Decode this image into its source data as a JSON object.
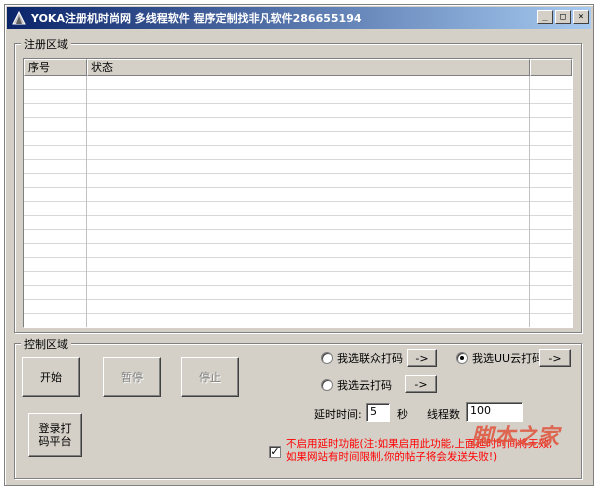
{
  "window": {
    "title": "YOKA注册机时尚网 多线程软件 程序定制找非凡软件286655194",
    "controls": [
      "_",
      "□",
      "×"
    ]
  },
  "register_area": {
    "legend": "注册区域",
    "columns": [
      "序号",
      "状态",
      ""
    ]
  },
  "control_area": {
    "legend": "控制区域",
    "start_label": "开始",
    "pause_label": "暂停",
    "stop_label": "停止",
    "login_platform_label": "登录打码平台",
    "radio_lianzhong": "我选联众打码",
    "radio_uu": "我选UU云打码",
    "radio_yun": "我选云打码",
    "arrow_label": "->",
    "delay_label": "延时时间:",
    "delay_value": "5",
    "delay_unit": "秒",
    "threads_label": "线程数",
    "threads_value": "100",
    "delay_check_mark": "✓",
    "delay_warning": "不启用延时功能(注:如果启用此功能,上面延时时间将无效,如果网站有时间限制,你的帖子将会发送失败!)"
  },
  "watermark": "脚本之家",
  "colors": {
    "face": "#d4d0c8",
    "title_start": "#0a246a",
    "title_end": "#a6caf0",
    "warning": "#ff0000"
  }
}
